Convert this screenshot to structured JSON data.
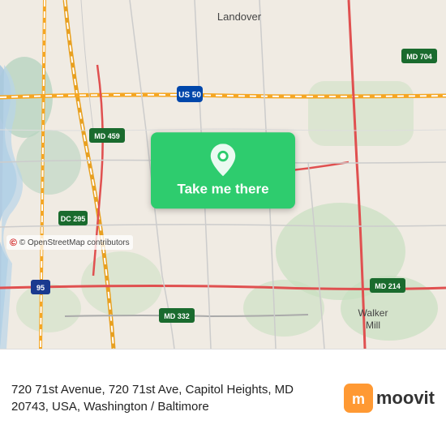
{
  "map": {
    "alt": "Map showing Capitol Heights, MD area",
    "center_lat": 38.89,
    "center_lng": -76.91
  },
  "button": {
    "label": "Take me there"
  },
  "copyright": {
    "text": "© OpenStreetMap contributors"
  },
  "address": {
    "line1": "720 71st Avenue, 720 71st Ave, Capitol Heights, MD",
    "line2": "20743, USA, Washington / Baltimore"
  },
  "moovit": {
    "label": "moovit"
  }
}
